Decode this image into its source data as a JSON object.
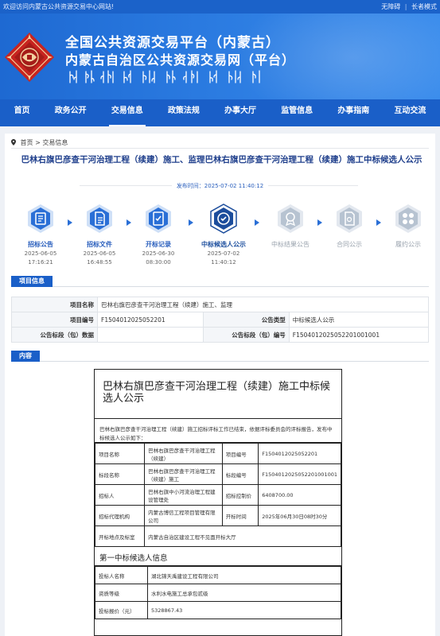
{
  "topbar": {
    "welcome": "欢迎访问内蒙古公共资源交易中心网站!",
    "accessible": "无障碍",
    "divider": "|",
    "elder": "长者模式"
  },
  "header": {
    "title_line1": "全国公共资源交易平台（内蒙古）",
    "title_line2": "内蒙古自治区公共资源交易网（平台）"
  },
  "nav": [
    {
      "label": "首页"
    },
    {
      "label": "政务公开"
    },
    {
      "label": "交易信息"
    },
    {
      "label": "政策法规"
    },
    {
      "label": "办事大厅"
    },
    {
      "label": "监管信息"
    },
    {
      "label": "办事指南"
    },
    {
      "label": "互动交流"
    }
  ],
  "breadcrumb": {
    "home": "首页",
    "sep": ">",
    "current": "交易信息"
  },
  "article": {
    "title": "巴林右旗巴彦查干河治理工程（续建）施工、监理巴林右旗巴彦查干河治理工程（续建）施工中标候选人公示",
    "publish_time": "发布时间：2025-07-02 11:40:12"
  },
  "steps": [
    {
      "label": "招标公告",
      "date": "2025-06-05",
      "time": "17:16:21",
      "state": "done",
      "icon": "announcement-icon"
    },
    {
      "label": "招标文件",
      "date": "2025-06-05",
      "time": "16:48:55",
      "state": "done",
      "icon": "document-icon"
    },
    {
      "label": "开标记录",
      "date": "2025-06-30",
      "time": "08:30:00",
      "state": "done",
      "icon": "record-icon"
    },
    {
      "label": "中标候选人公示",
      "date": "2025-07-02",
      "time": "11:40:12",
      "state": "active",
      "icon": "candidate-icon"
    },
    {
      "label": "中标结果公告",
      "date": "",
      "time": "",
      "state": "pending",
      "icon": "award-icon"
    },
    {
      "label": "合同公示",
      "date": "",
      "time": "",
      "state": "pending",
      "icon": "contract-icon"
    },
    {
      "label": "履约公示",
      "date": "",
      "time": "",
      "state": "pending",
      "icon": "performance-icon"
    }
  ],
  "project_info": {
    "section_label": "项目信息",
    "name_key": "项目名称",
    "name_value": "巴林右旗巴彦查干河治理工程（续建）施工、监理",
    "code_key": "项目编号",
    "code_value": "F1504012025052201",
    "type_key": "公告类型",
    "type_value": "中标候选人公示",
    "section_key": "公告标段（包）数据",
    "section_value": "",
    "section_code_key": "公告标段（包）编号",
    "section_code_value": "F1504012025052201001001"
  },
  "content": {
    "section_label": "内容",
    "doc_title": "巴林右旗巴彦查干河治理工程（续建）施工中标候选人公示",
    "intro": "巴林右旗巴彦查干河治理工程（续建）施工招标评标工作已结束，依据评标委员会的评标报告，发布中标候选人公示如下：",
    "rows": {
      "proj_name_k": "项目名称",
      "proj_name_v": "巴林右旗巴彦查干河治理工程（续建）",
      "proj_code_k": "项目编号",
      "proj_code_v": "F1504012025052201",
      "lot_name_k": "标段名称",
      "lot_name_v": "巴林右旗巴彦查干河治理工程（续建）施工",
      "lot_code_k": "标段编号",
      "lot_code_v": "F1504012025052201001001",
      "tenderer_k": "招标人",
      "tenderer_v": "巴林右旗中小河流治理工程建设管理处",
      "ceiling_k": "招标控制价",
      "ceiling_v": "6408700.00",
      "agency_k": "招标代理机构",
      "agency_v": "内蒙古博信工程项目管理有限公司",
      "open_k": "开标时间",
      "open_v": "2025年06月30日08时30分",
      "place_k": "开标地点及标室",
      "place_v": "内蒙古自治区建设工程不见面开标大厅"
    },
    "first_title": "第一中标候选人信息",
    "first": {
      "name_k": "投标人名称",
      "name_v": "湖北锦天禹建设工程有限公司",
      "qual_k": "资质等级",
      "qual_v": "水利水电施工总承包贰级",
      "price_k": "投标报价（元）",
      "price_v": "5328867.43"
    }
  },
  "colors": {
    "brand": "#1a5fc8",
    "banner": "#2a7ae0",
    "title": "#1f3f8c",
    "pending": "#b7c3d1"
  }
}
